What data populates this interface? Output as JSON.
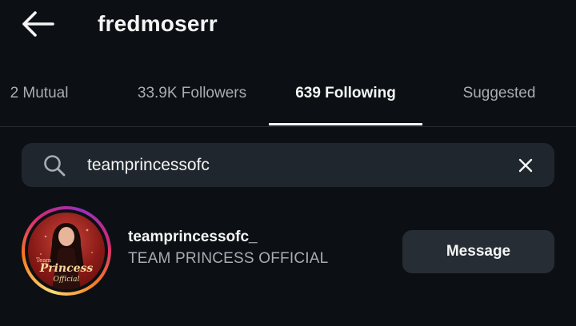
{
  "header": {
    "title": "fredmoserr",
    "back_icon": "arrow-left-icon"
  },
  "tabs": [
    {
      "label": "2 Mutual",
      "active": false
    },
    {
      "label": "33.9K Followers",
      "active": false
    },
    {
      "label": "639 Following",
      "active": true
    },
    {
      "label": "Suggested",
      "active": false
    }
  ],
  "search": {
    "value": "teamprincessofc",
    "icon": "search-icon",
    "clear_icon": "close-icon"
  },
  "results": [
    {
      "username": "teamprincessofc_",
      "full_name": "TEAM PRINCESS OFFICIAL",
      "has_story_ring": true,
      "avatar_logo": {
        "line1": "Team",
        "line2": "Princess",
        "line3": "Official"
      },
      "action_label": "Message"
    }
  ],
  "colors": {
    "background": "#0c1014",
    "search_bg": "#1f262d",
    "button_bg": "#262d34",
    "secondary_text": "#a8adb3"
  }
}
